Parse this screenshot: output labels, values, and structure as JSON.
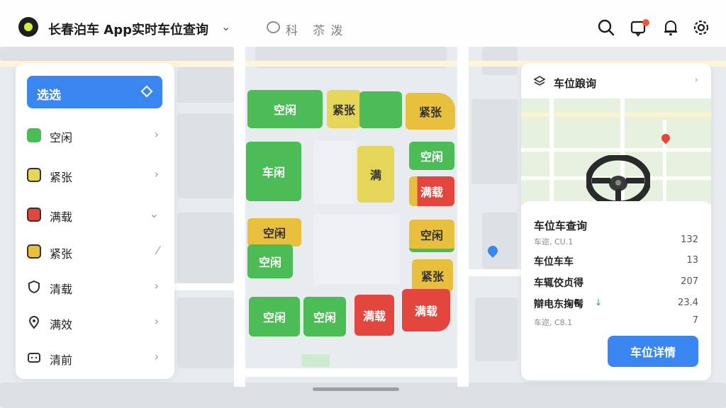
{
  "header": {
    "app_title": "长春泊车 App实时车位查询",
    "subtitle": "科 苶泼"
  },
  "left_panel": {
    "select_label": "选选",
    "items": [
      {
        "label": "空闲",
        "icon": "parking-free-icon",
        "color": "#4cbc56",
        "chevron": "›"
      },
      {
        "label": "紧张",
        "icon": "parking-busy-icon",
        "color": "#e5d65a",
        "chevron": "›"
      },
      {
        "label": "满载",
        "icon": "parking-full-icon",
        "color": "#e3463d",
        "chevron": "⌄"
      },
      {
        "label": "紧张",
        "icon": "parking-level-icon",
        "color": "#e9bf3e",
        "chevron": "⁄"
      },
      {
        "label": "清载",
        "icon": "shield-icon",
        "color": "#555555",
        "chevron": "›"
      },
      {
        "label": "满效",
        "icon": "location-pin-icon",
        "color": "#555555",
        "chevron": "›"
      },
      {
        "label": "清前",
        "icon": "message-icon",
        "color": "#555555",
        "chevron": "›"
      }
    ]
  },
  "lots": [
    {
      "label": "空闲",
      "status": "free"
    },
    {
      "label": "紧张",
      "status": "busy"
    },
    {
      "label": "",
      "status": "free"
    },
    {
      "label": "紧张",
      "status": "busy2"
    },
    {
      "label": "车闲",
      "status": "free"
    },
    {
      "label": "满",
      "status": "busy"
    },
    {
      "label": "空闲",
      "status": "free"
    },
    {
      "label": "满载",
      "status": "full"
    },
    {
      "label": "空闲",
      "status": "busy2"
    },
    {
      "label": "空闲",
      "status": "free"
    },
    {
      "label": "空闲",
      "status": "busy2"
    },
    {
      "label": "紧张",
      "status": "busy2"
    },
    {
      "label": "空闲",
      "status": "free"
    },
    {
      "label": "空闲",
      "status": "free"
    },
    {
      "label": "满载",
      "status": "full"
    },
    {
      "label": "满载",
      "status": "full"
    }
  ],
  "right_panel": {
    "title": "车位踉询",
    "stats_title": "车位车查询",
    "rows": [
      {
        "key": "车迩, CU.1",
        "value": "132",
        "small": true
      },
      {
        "key": "车位车车",
        "value": "13",
        "small": false
      },
      {
        "key": "车辄佼贞得",
        "value": "207",
        "small": false
      },
      {
        "key": "辯电东掬髩",
        "value": "23.4",
        "small": false
      },
      {
        "key": "车迩, C8.1",
        "value": "7",
        "small": true
      }
    ],
    "detail_button": "车位详情"
  },
  "colors": {
    "accent": "#3a86f0",
    "free": "#4cbc56",
    "busy": "#e5d65a",
    "full": "#e3463d"
  }
}
